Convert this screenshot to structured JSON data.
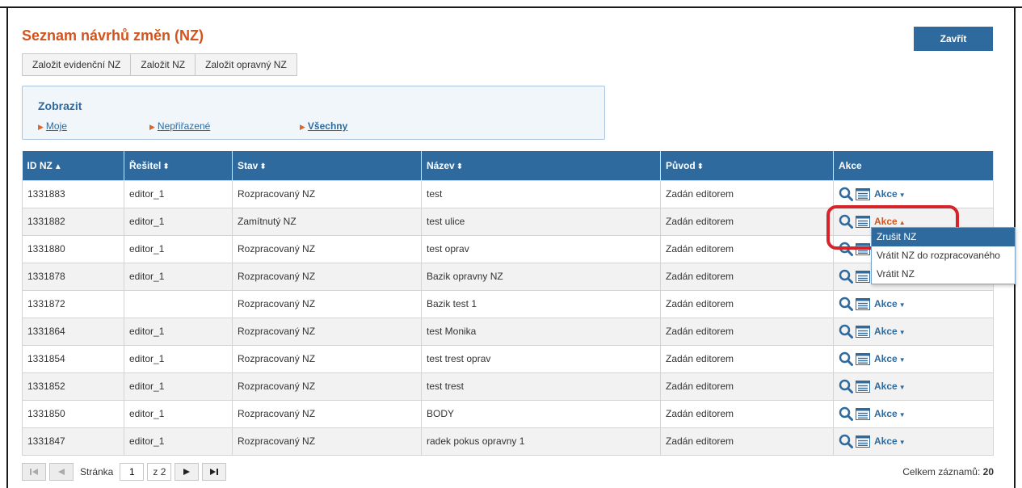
{
  "page": {
    "title": "Seznam návrhů změn (NZ)",
    "close_label": "Zavřít"
  },
  "create_buttons": [
    {
      "label": "Založit evidenční NZ"
    },
    {
      "label": "Založit NZ"
    },
    {
      "label": "Založit opravný NZ"
    }
  ],
  "filter": {
    "title": "Zobrazit",
    "options": [
      {
        "label": "Moje",
        "active": false
      },
      {
        "label": "Nepřiřazené",
        "active": false
      },
      {
        "label": "Všechny",
        "active": true
      }
    ]
  },
  "table": {
    "columns": [
      {
        "label": "ID NZ",
        "sort_icon": "sort-asc-icon"
      },
      {
        "label": "Řešitel",
        "sort_icon": "sort-icon"
      },
      {
        "label": "Stav",
        "sort_icon": "sort-icon"
      },
      {
        "label": "Název",
        "sort_icon": "sort-icon"
      },
      {
        "label": "Původ",
        "sort_icon": "sort-icon"
      },
      {
        "label": "Akce",
        "sort_icon": ""
      }
    ],
    "rows": [
      {
        "id": "1331883",
        "resitel": "editor_1",
        "stav": "Rozpracovaný NZ",
        "nazev": "test",
        "puvod": "Zadán editorem",
        "akce": "Akce",
        "open": false
      },
      {
        "id": "1331882",
        "resitel": "editor_1",
        "stav": "Zamítnutý NZ",
        "nazev": "test ulice",
        "puvod": "Zadán editorem",
        "akce": "Akce",
        "open": true
      },
      {
        "id": "1331880",
        "resitel": "editor_1",
        "stav": "Rozpracovaný NZ",
        "nazev": "test oprav",
        "puvod": "Zadán editorem",
        "akce": "Akce",
        "open": false
      },
      {
        "id": "1331878",
        "resitel": "editor_1",
        "stav": "Rozpracovaný NZ",
        "nazev": "Bazik opravny NZ",
        "puvod": "Zadán editorem",
        "akce": "Akce",
        "open": false
      },
      {
        "id": "1331872",
        "resitel": "",
        "stav": "Rozpracovaný NZ",
        "nazev": "Bazik test 1",
        "puvod": "Zadán editorem",
        "akce": "Akce",
        "open": false
      },
      {
        "id": "1331864",
        "resitel": "editor_1",
        "stav": "Rozpracovaný NZ",
        "nazev": "test Monika",
        "puvod": "Zadán editorem",
        "akce": "Akce",
        "open": false
      },
      {
        "id": "1331854",
        "resitel": "editor_1",
        "stav": "Rozpracovaný NZ",
        "nazev": "test trest oprav",
        "puvod": "Zadán editorem",
        "akce": "Akce",
        "open": false
      },
      {
        "id": "1331852",
        "resitel": "editor_1",
        "stav": "Rozpracovaný NZ",
        "nazev": "test trest",
        "puvod": "Zadán editorem",
        "akce": "Akce",
        "open": false
      },
      {
        "id": "1331850",
        "resitel": "editor_1",
        "stav": "Rozpracovaný NZ",
        "nazev": "BODY",
        "puvod": "Zadán editorem",
        "akce": "Akce",
        "open": false
      },
      {
        "id": "1331847",
        "resitel": "editor_1",
        "stav": "Rozpracovaný NZ",
        "nazev": "radek pokus opravny 1",
        "puvod": "Zadán editorem",
        "akce": "Akce",
        "open": false
      }
    ]
  },
  "dropdown": {
    "items": [
      {
        "label": "Zrušit NZ",
        "selected": true
      },
      {
        "label": "Vrátit NZ do rozpracovaného",
        "selected": false
      },
      {
        "label": "Vrátit NZ",
        "selected": false
      }
    ]
  },
  "pager": {
    "page_label": "Stránka",
    "current_page": "1",
    "of_label": "z 2",
    "total_label": "Celkem záznamů:",
    "total_count": "20"
  },
  "colors": {
    "accent": "#2e6a9e",
    "title": "#d2541c",
    "highlight": "#d6242b"
  }
}
